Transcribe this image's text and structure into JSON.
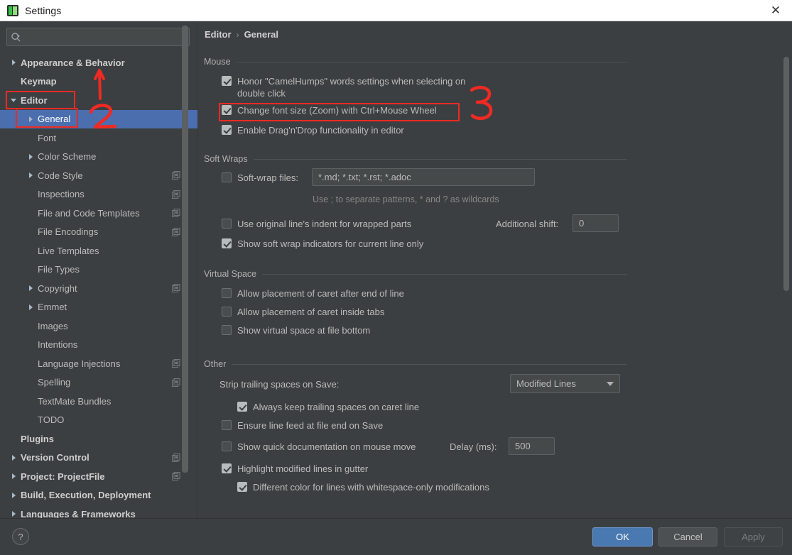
{
  "window": {
    "title": "Settings",
    "icon": "intellij-idea-icon",
    "close_label": "✕"
  },
  "sidebar": {
    "search": {
      "placeholder": "",
      "value": "",
      "icon": "search-icon"
    },
    "items": [
      {
        "label": "Appearance & Behavior",
        "indent": 1,
        "arrow": "closed",
        "bold": true,
        "selected": false,
        "badge": false
      },
      {
        "label": "Keymap",
        "indent": 1,
        "arrow": "none",
        "bold": true,
        "selected": false,
        "badge": false
      },
      {
        "label": "Editor",
        "indent": 1,
        "arrow": "open",
        "bold": true,
        "selected": false,
        "badge": false
      },
      {
        "label": "General",
        "indent": 2,
        "arrow": "closed",
        "bold": false,
        "selected": true,
        "badge": false
      },
      {
        "label": "Font",
        "indent": 2,
        "arrow": "none",
        "bold": false,
        "selected": false,
        "badge": false
      },
      {
        "label": "Color Scheme",
        "indent": 2,
        "arrow": "closed",
        "bold": false,
        "selected": false,
        "badge": false
      },
      {
        "label": "Code Style",
        "indent": 2,
        "arrow": "closed",
        "bold": false,
        "selected": false,
        "badge": true
      },
      {
        "label": "Inspections",
        "indent": 2,
        "arrow": "none",
        "bold": false,
        "selected": false,
        "badge": true
      },
      {
        "label": "File and Code Templates",
        "indent": 2,
        "arrow": "none",
        "bold": false,
        "selected": false,
        "badge": true
      },
      {
        "label": "File Encodings",
        "indent": 2,
        "arrow": "none",
        "bold": false,
        "selected": false,
        "badge": true
      },
      {
        "label": "Live Templates",
        "indent": 2,
        "arrow": "none",
        "bold": false,
        "selected": false,
        "badge": false
      },
      {
        "label": "File Types",
        "indent": 2,
        "arrow": "none",
        "bold": false,
        "selected": false,
        "badge": false
      },
      {
        "label": "Copyright",
        "indent": 2,
        "arrow": "closed",
        "bold": false,
        "selected": false,
        "badge": true
      },
      {
        "label": "Emmet",
        "indent": 2,
        "arrow": "closed",
        "bold": false,
        "selected": false,
        "badge": false
      },
      {
        "label": "Images",
        "indent": 2,
        "arrow": "none",
        "bold": false,
        "selected": false,
        "badge": false
      },
      {
        "label": "Intentions",
        "indent": 2,
        "arrow": "none",
        "bold": false,
        "selected": false,
        "badge": false
      },
      {
        "label": "Language Injections",
        "indent": 2,
        "arrow": "none",
        "bold": false,
        "selected": false,
        "badge": true
      },
      {
        "label": "Spelling",
        "indent": 2,
        "arrow": "none",
        "bold": false,
        "selected": false,
        "badge": true
      },
      {
        "label": "TextMate Bundles",
        "indent": 2,
        "arrow": "none",
        "bold": false,
        "selected": false,
        "badge": false
      },
      {
        "label": "TODO",
        "indent": 2,
        "arrow": "none",
        "bold": false,
        "selected": false,
        "badge": false
      },
      {
        "label": "Plugins",
        "indent": 1,
        "arrow": "none",
        "bold": true,
        "selected": false,
        "badge": false
      },
      {
        "label": "Version Control",
        "indent": 1,
        "arrow": "closed",
        "bold": true,
        "selected": false,
        "badge": true
      },
      {
        "label": "Project: ProjectFile",
        "indent": 1,
        "arrow": "closed",
        "bold": true,
        "selected": false,
        "badge": true
      },
      {
        "label": "Build, Execution, Deployment",
        "indent": 1,
        "arrow": "closed",
        "bold": true,
        "selected": false,
        "badge": false
      },
      {
        "label": "Languages & Frameworks",
        "indent": 1,
        "arrow": "closed",
        "bold": true,
        "selected": false,
        "badge": false
      }
    ]
  },
  "breadcrumb": {
    "root": "Editor",
    "separator": "›",
    "leaf": "General"
  },
  "sections": {
    "mouse": {
      "title": "Mouse",
      "items": [
        {
          "label": "Honor \"CamelHumps\" words settings when selecting on double click",
          "checked": true
        },
        {
          "label": "Change font size (Zoom) with Ctrl+Mouse Wheel",
          "checked": true
        },
        {
          "label": "Enable Drag'n'Drop functionality in editor",
          "checked": true
        }
      ]
    },
    "soft_wraps": {
      "title": "Soft Wraps",
      "soft_wrap_files": {
        "label": "Soft-wrap files:",
        "checked": false,
        "value": "*.md; *.txt; *.rst; *.adoc"
      },
      "hint": "Use ; to separate patterns, * and ? as wildcards",
      "original_indent": {
        "label": "Use original line's indent for wrapped parts",
        "checked": false
      },
      "additional_shift": {
        "label": "Additional shift:",
        "value": "0"
      },
      "show_indicators": {
        "label": "Show soft wrap indicators for current line only",
        "checked": true
      }
    },
    "virtual_space": {
      "title": "Virtual Space",
      "items": [
        {
          "label": "Allow placement of caret after end of line",
          "checked": false
        },
        {
          "label": "Allow placement of caret inside tabs",
          "checked": false
        },
        {
          "label": "Show virtual space at file bottom",
          "checked": false
        }
      ]
    },
    "other": {
      "title": "Other",
      "strip_trailing": {
        "label": "Strip trailing spaces on Save:",
        "value": "Modified Lines"
      },
      "always_keep": {
        "label": "Always keep trailing spaces on caret line",
        "checked": true
      },
      "ensure_line_feed": {
        "label": "Ensure line feed at file end on Save",
        "checked": false
      },
      "quick_doc": {
        "label": "Show quick documentation on mouse move",
        "checked": false
      },
      "delay": {
        "label": "Delay (ms):",
        "value": "500"
      },
      "highlight_modified": {
        "label": "Highlight modified lines in gutter",
        "checked": true
      },
      "different_color": {
        "label": "Different color for lines with whitespace-only modifications",
        "checked": true
      }
    }
  },
  "footer": {
    "help": "?",
    "ok": "OK",
    "cancel": "Cancel",
    "apply": "Apply"
  },
  "annotations": {
    "color": "#f02a23",
    "marks": [
      {
        "text": "1",
        "kind": "arrow-up"
      },
      {
        "text": "2",
        "kind": "digit"
      },
      {
        "text": "3",
        "kind": "digit"
      }
    ]
  }
}
